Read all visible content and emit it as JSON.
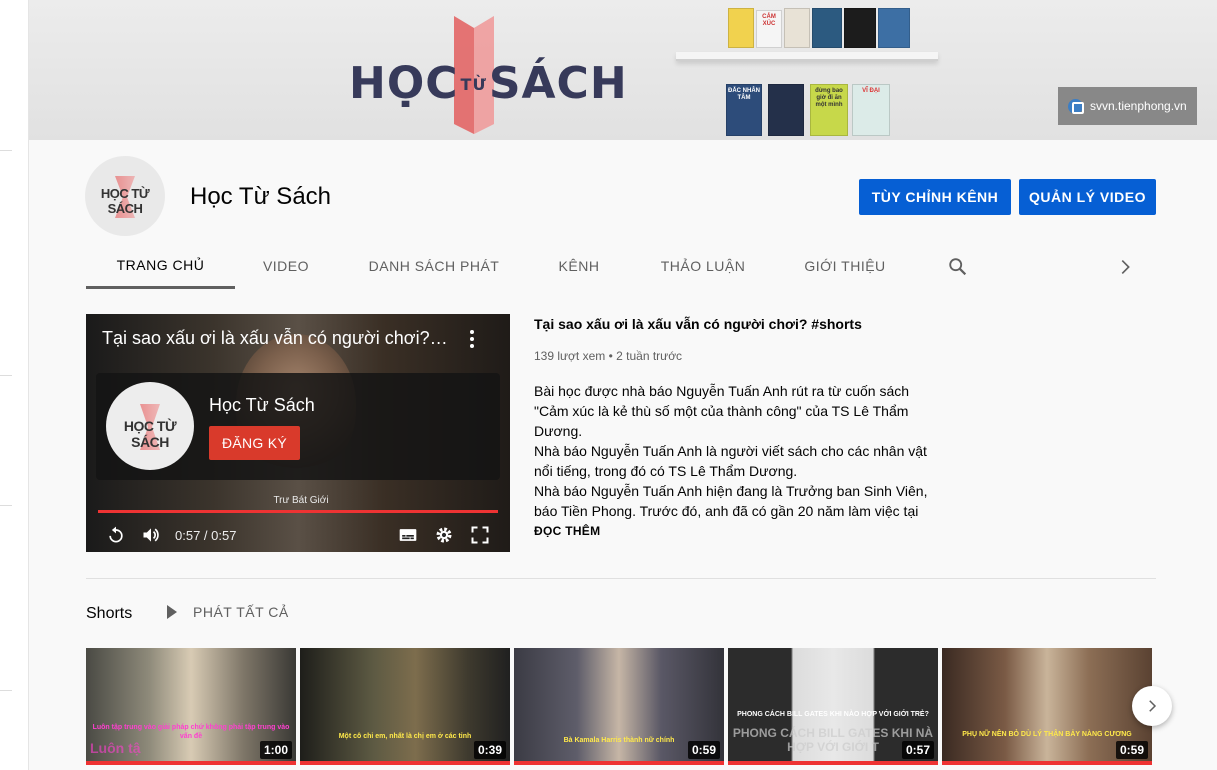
{
  "banner": {
    "logo_main_left": "HỌC",
    "logo_small": "TỪ",
    "logo_main_right": "SÁCH",
    "watermark": "svvn.tienphong.vn",
    "book_titles": [
      "CẢM XÚC",
      "ĐẮC NHÂN TÂM",
      "VĨ ĐẠI",
      "đừng bao giờ đi ăn một mình"
    ]
  },
  "channel": {
    "name": "Học Từ Sách",
    "avatar_text": "HỌC TỪ SÁCH",
    "customize_button": "TÙY CHỈNH KÊNH",
    "manage_button": "QUẢN LÝ VIDEO"
  },
  "tabs": [
    {
      "label": "TRANG CHỦ",
      "active": true
    },
    {
      "label": "VIDEO"
    },
    {
      "label": "DANH SÁCH PHÁT"
    },
    {
      "label": "KÊNH"
    },
    {
      "label": "THẢO LUẬN"
    },
    {
      "label": "GIỚI THIỆU"
    }
  ],
  "icons": {
    "search": "search-icon",
    "chevron_right": "chevron-right-icon",
    "replay": "replay-icon",
    "volume": "volume-icon",
    "subtitles": "subtitles-icon",
    "settings": "gear-icon",
    "fullscreen": "fullscreen-icon",
    "more": "more-vert-icon"
  },
  "player": {
    "title": "Tại sao xấu ơi là xấu vẫn có người chơi? #shorts",
    "endcard_channel": "Học Từ Sách",
    "subscribe": "ĐĂNG KÝ",
    "caption": "Trư Bát Giới",
    "time": "0:57 / 0:57",
    "progress": 1.0
  },
  "featured": {
    "title": "Tại sao xấu ơi là xấu vẫn có người chơi? #shorts",
    "meta": "139 lượt xem • 2 tuần trước",
    "description": [
      "Bài học được nhà báo Nguyễn Tuấn Anh rút ra từ cuốn sách \"Cảm xúc là kẻ thù số một của thành công\" của TS Lê Thẩm Dương.",
      "Nhà báo Nguyễn Tuấn Anh là người viết sách cho các nhân vật nổi tiếng, trong đó có TS Lê Thẩm Dương.",
      "Nhà báo Nguyễn Tuấn Anh hiện đang là Trưởng ban Sinh Viên, báo Tiền Phong. Trước đó, anh đã có gần 20 năm làm việc tại báo Sinh Viên Việt Nam - Hoa Học Trò."
    ],
    "read_more": "ĐỌC THÊM"
  },
  "shorts_shelf": {
    "title": "Shorts",
    "play_all": "PHÁT TẤT CẢ",
    "items": [
      {
        "duration": "1:00",
        "caption": "Luôn tập trung vào giải pháp chứ không phải tập trung vào vấn đề",
        "bottom_text": "Luôn tậ",
        "bg": "#6b6355"
      },
      {
        "duration": "0:39",
        "caption": "Một cô chi em, nhất là chị em ở các tỉnh",
        "bottom_text": "",
        "bg": "#3d3b2e"
      },
      {
        "duration": "0:59",
        "caption": "Bà Kamala Harris thành nữ chính",
        "bottom_text": "",
        "bg": "#3a3a40"
      },
      {
        "duration": "0:57",
        "caption": "PHONG CÁCH BILL GATES KHI NÀO HỢP VỚI GIỚI TRẺ?",
        "bottom_text": "PHONG CÁCH BILL GATES KHI NÀ HỢP VỚI GIỚI T",
        "bg": "#2f2f2f"
      },
      {
        "duration": "0:59",
        "caption": "PHỤ NỮ NÊN BỎ DÙ LÝ THẬN BẢY NÀNG CƯƠNG",
        "bottom_text": "",
        "bg": "#4a3b30"
      }
    ]
  },
  "colors": {
    "primary_blue": "#065fd4",
    "subscribe_red": "#d93a2b",
    "progress_red": "#e33333"
  }
}
